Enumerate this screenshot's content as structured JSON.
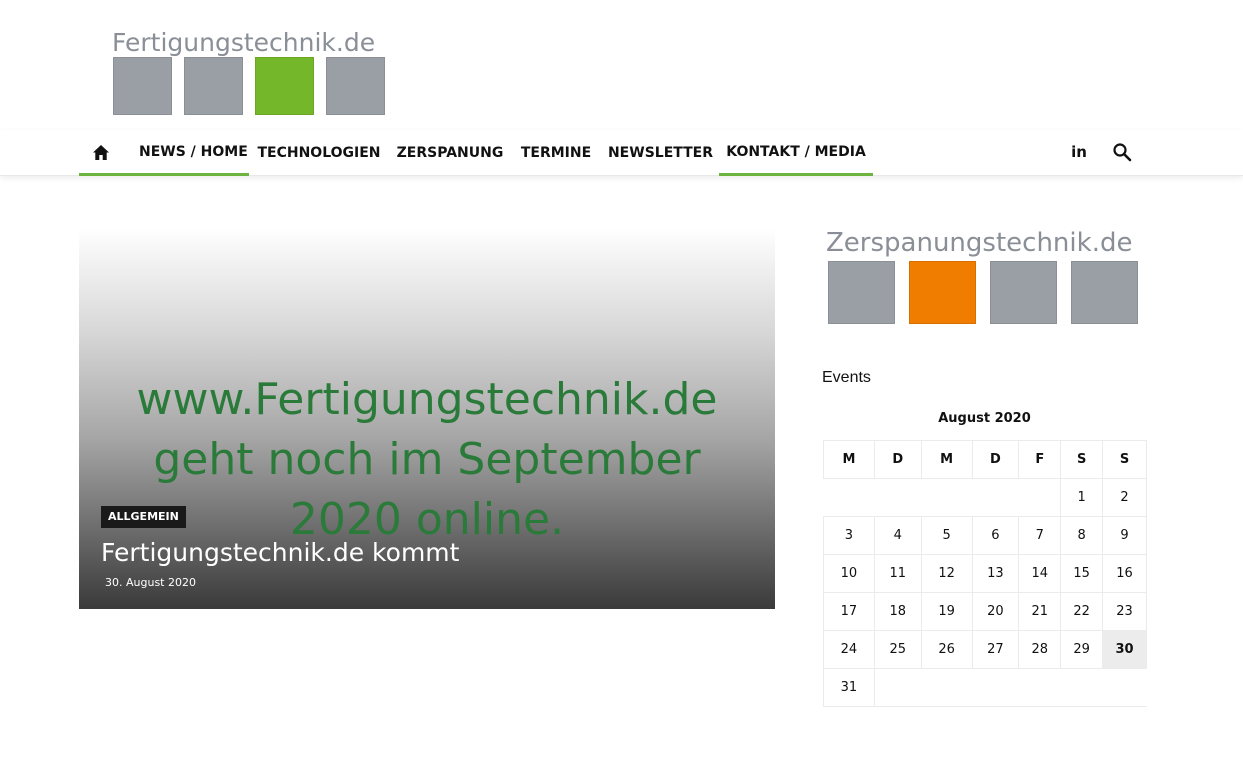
{
  "header": {
    "logo_text": "Fertigungstechnik.de",
    "logo_squares": [
      "#9a9ea5",
      "#9a9ea5",
      "#74b72b",
      "#9a9ea5"
    ]
  },
  "nav": {
    "items": [
      {
        "label": "NEWS / HOME"
      },
      {
        "label": "TECHNOLOGIEN"
      },
      {
        "label": "ZERSPANUNG"
      },
      {
        "label": "TERMINE"
      },
      {
        "label": "NEWSLETTER"
      },
      {
        "label": "KONTAKT / MEDIA"
      }
    ],
    "active_color": "#6cb33f",
    "linkedin_label": "in"
  },
  "featured": {
    "image_text_lines": [
      "www.Fertigungstechnik.de",
      "geht noch im September",
      "2020 online."
    ],
    "category": "ALLGEMEIN",
    "title": "Fertigungstechnik.de kommt",
    "date": "30. August 2020"
  },
  "sidebar": {
    "logo_text": "Zerspanungstechnik.de",
    "logo_squares": [
      "#9a9ea5",
      "#f07d00",
      "#9a9ea5",
      "#9a9ea5"
    ],
    "events_title": "Events",
    "calendar": {
      "caption": "August 2020",
      "weekdays": [
        "M",
        "D",
        "M",
        "D",
        "F",
        "S",
        "S"
      ],
      "today": "30"
    }
  }
}
